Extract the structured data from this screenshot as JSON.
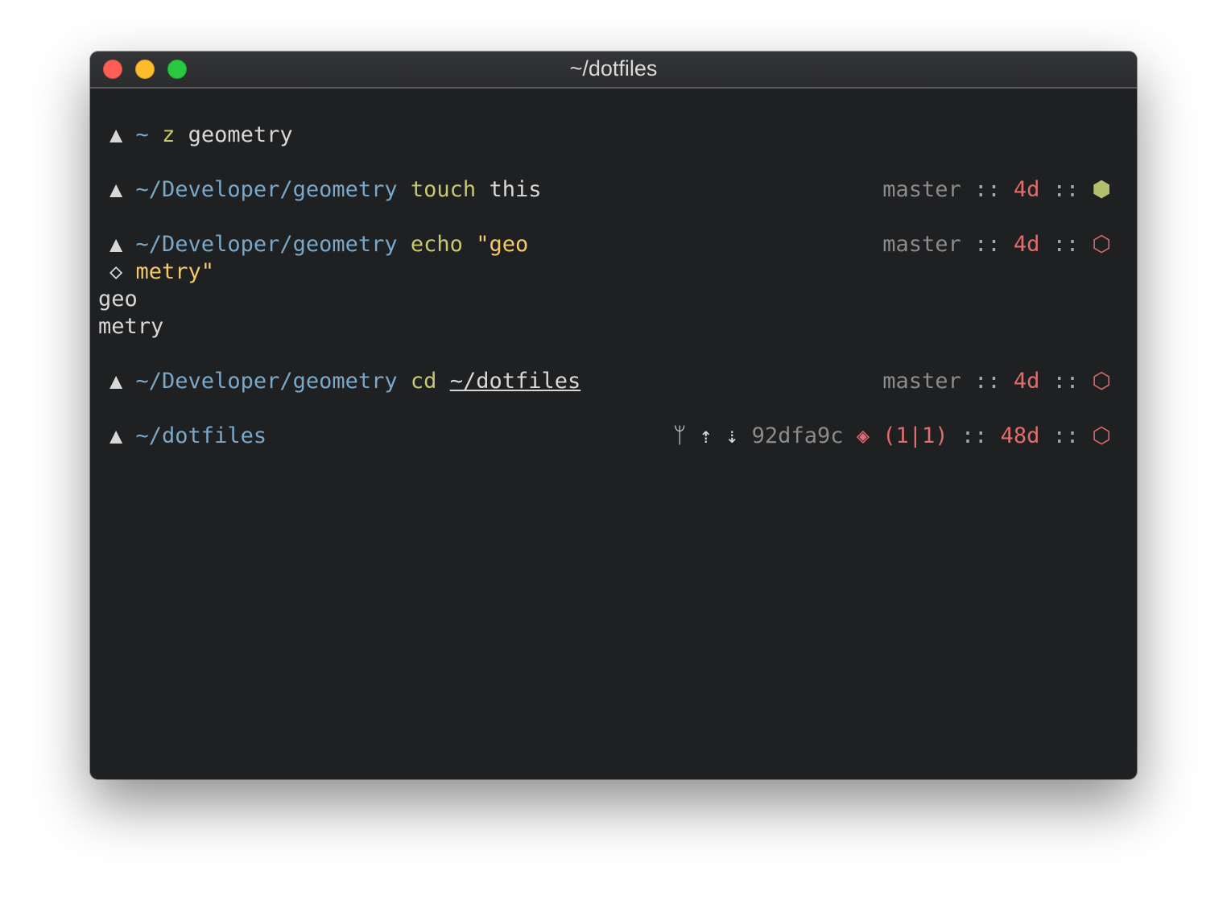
{
  "window": {
    "title": "~/dotfiles",
    "colors": {
      "background": "#1f2022",
      "directory": "#79a8c9",
      "command": "#c8c870",
      "string": "#f3c969",
      "git_time": "#e06c6c",
      "exit_success": "#b4c06c",
      "exit_failure": "#e06c6c"
    }
  },
  "prompt_symbol": "▲",
  "continuation_symbol": "◇",
  "separator": "::",
  "lines": [
    {
      "dir": "~",
      "cmd": "z",
      "arg": "geometry"
    },
    {
      "dir": "~/Developer/geometry",
      "cmd": "touch",
      "arg": "this",
      "right": {
        "branch": "master",
        "time": "4d",
        "status_icon": "filled-hexagon-icon",
        "status_glyph": "⬢"
      }
    },
    {
      "dir": "~/Developer/geometry",
      "cmd": "echo",
      "arg": "\"geo",
      "right": {
        "branch": "master",
        "time": "4d",
        "status_icon": "hexagon-outline-icon",
        "status_glyph": "⬡"
      }
    },
    {
      "continuation": "metry\""
    },
    {
      "output": "geo"
    },
    {
      "output": "metry"
    },
    {
      "dir": "~/Developer/geometry",
      "cmd": "cd",
      "arg": "~/dotfiles",
      "right": {
        "branch": "master",
        "time": "4d",
        "status_icon": "hexagon-outline-icon",
        "status_glyph": "⬡"
      }
    },
    {
      "dir": "~/dotfiles",
      "right": {
        "rebase_icon": "git-branch-icon",
        "rebase_glyph": "ᛘ",
        "ahead_glyph": "⇡",
        "behind_glyph": "⇣",
        "commit": "92dfa9c",
        "conflict_glyph": "◈",
        "conflicts": "(1|1)",
        "time": "48d",
        "status_icon": "hexagon-outline-icon",
        "status_glyph": "⬡"
      }
    }
  ]
}
